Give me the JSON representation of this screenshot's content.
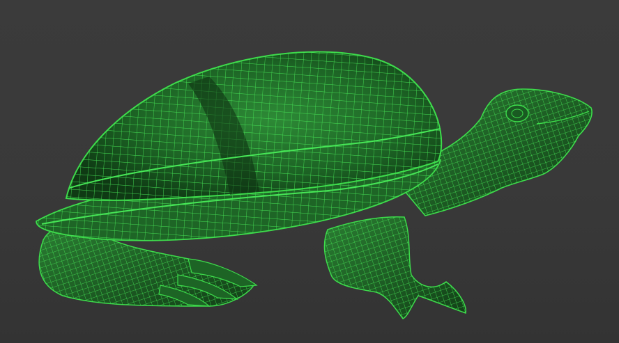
{
  "viewport": {
    "subject": "turtle-wireframe",
    "background_color": "#3a3a3a",
    "wire_color": "#3ddc4b",
    "fill_color": "#1a5a22"
  }
}
